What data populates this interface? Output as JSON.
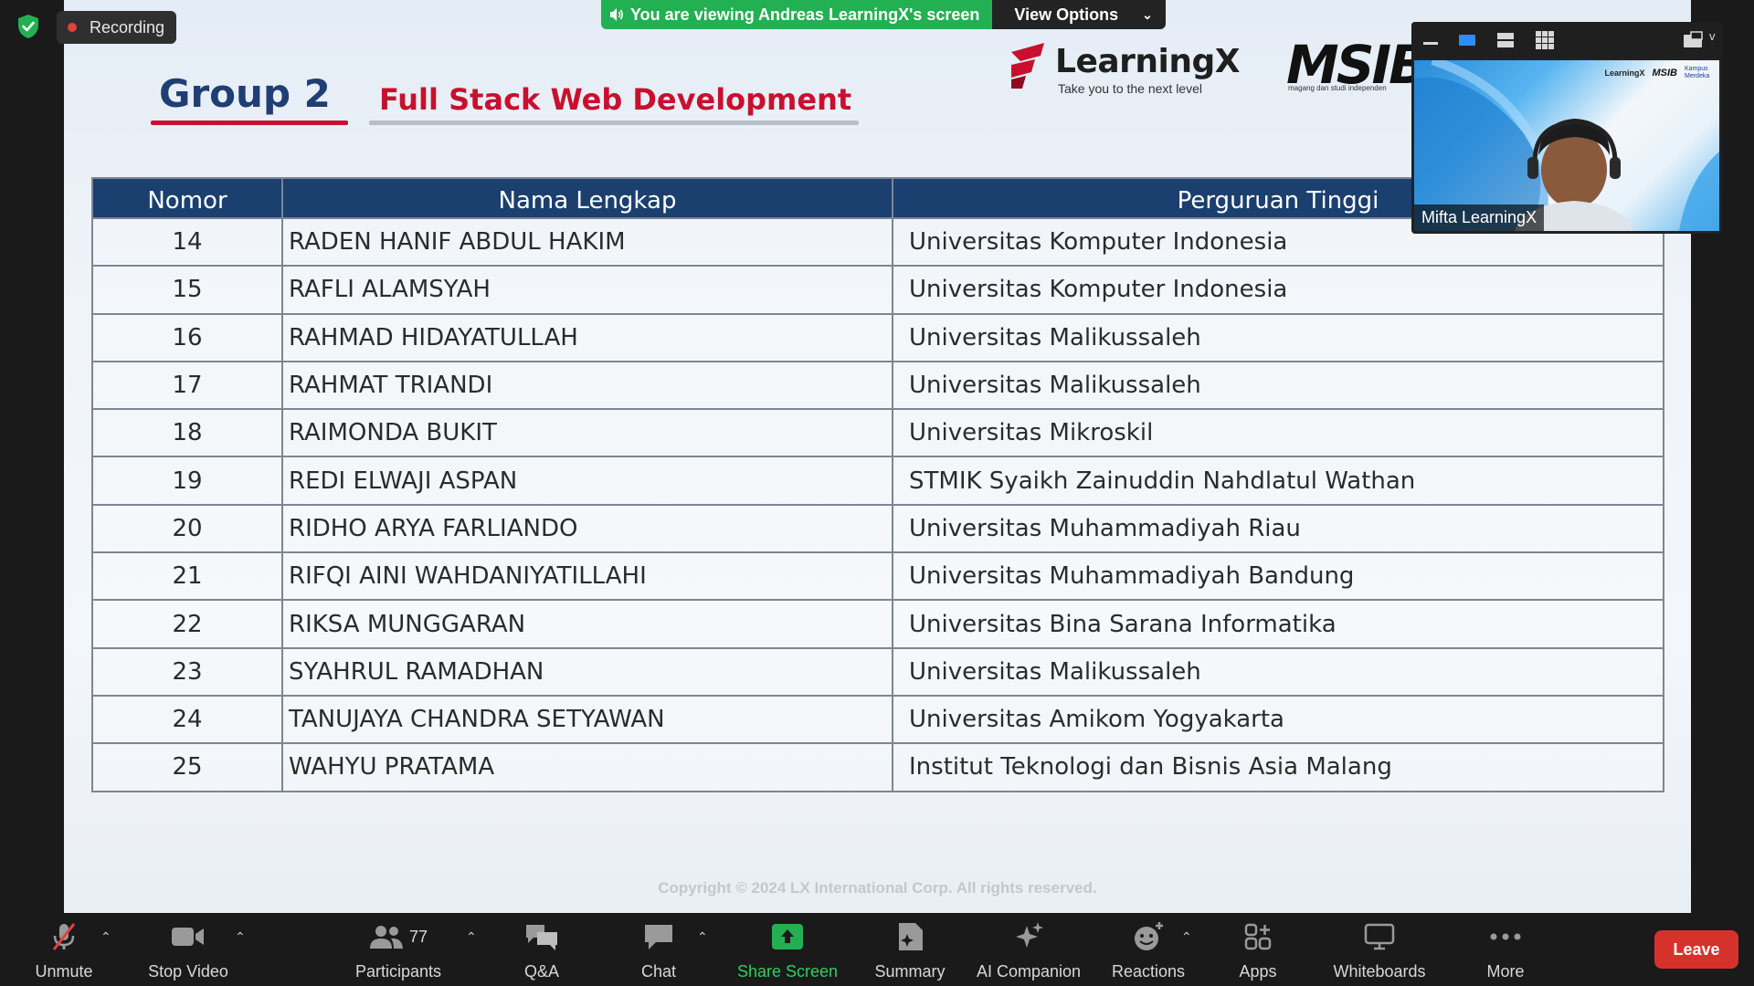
{
  "meeting": {
    "recording_label": "Recording",
    "viewing_banner": "You are viewing Andreas LearningX's screen",
    "view_options_label": "View Options"
  },
  "slide": {
    "group_title": "Group 2",
    "course_title": "Full Stack Web Development",
    "logo_learningx_word": "LearningX",
    "logo_learningx_tagline": "Take you to the next level",
    "logo_msib_word": "MSIB",
    "logo_msib_tagline": "magang dan studi independen",
    "table": {
      "headers": [
        "Nomor",
        "Nama Lengkap",
        "Perguruan Tinggi"
      ],
      "rows": [
        {
          "num": "14",
          "name": "RADEN HANIF ABDUL HAKIM",
          "uni": "Universitas Komputer Indonesia"
        },
        {
          "num": "15",
          "name": "RAFLI ALAMSYAH",
          "uni": "Universitas Komputer Indonesia"
        },
        {
          "num": "16",
          "name": "RAHMAD HIDAYATULLAH",
          "uni": "Universitas Malikussaleh"
        },
        {
          "num": "17",
          "name": "RAHMAT TRIANDI",
          "uni": "Universitas Malikussaleh"
        },
        {
          "num": "18",
          "name": "RAIMONDA BUKIT",
          "uni": "Universitas Mikroskil"
        },
        {
          "num": "19",
          "name": "REDI ELWAJI ASPAN",
          "uni": "STMIK Syaikh Zainuddin Nahdlatul Wathan"
        },
        {
          "num": "20",
          "name": "RIDHO ARYA FARLIANDO",
          "uni": "Universitas Muhammadiyah Riau"
        },
        {
          "num": "21",
          "name": "RIFQI AINI WAHDANIYATILLAHI",
          "uni": "Universitas Muhammadiyah Bandung"
        },
        {
          "num": "22",
          "name": "RIKSA MUNGGARAN",
          "uni": "Universitas Bina Sarana Informatika"
        },
        {
          "num": "23",
          "name": "SYAHRUL RAMADHAN",
          "uni": "Universitas Malikussaleh"
        },
        {
          "num": "24",
          "name": "TANUJAYA CHANDRA SETYAWAN",
          "uni": "Universitas Amikom Yogyakarta"
        },
        {
          "num": "25",
          "name": "WAHYU PRATAMA",
          "uni": "Institut Teknologi dan Bisnis Asia Malang"
        }
      ]
    },
    "copyright": "Copyright © 2024 LX International Corp. All rights reserved."
  },
  "video_tile": {
    "participant_name": "Mifta LearningX",
    "mini_logos": {
      "learningx": "LearningX",
      "msib": "MSIB",
      "kampus": "Kampus Merdeka"
    }
  },
  "toolbar": {
    "unmute": "Unmute",
    "stop_video": "Stop Video",
    "participants": "Participants",
    "participants_count": "77",
    "qa": "Q&A",
    "chat": "Chat",
    "share_screen": "Share Screen",
    "summary": "Summary",
    "ai_companion": "AI Companion",
    "reactions": "Reactions",
    "apps": "Apps",
    "whiteboards": "Whiteboards",
    "more": "More",
    "leave": "Leave"
  },
  "colors": {
    "header_blue": "#1b3f6e",
    "accent_red": "#c8102e",
    "share_green": "#23b052",
    "leave_red": "#d6322c"
  }
}
